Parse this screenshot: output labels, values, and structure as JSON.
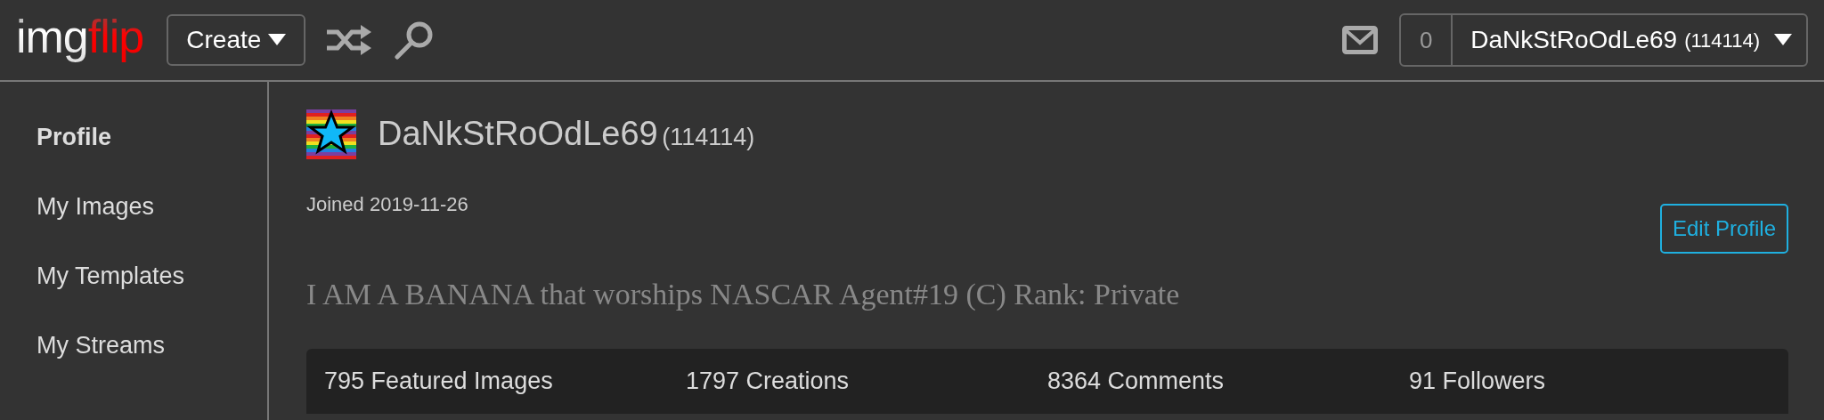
{
  "header": {
    "logo": {
      "part_1": "img",
      "part_2": "flip"
    },
    "create_button": "Create",
    "notifications_count": "0",
    "user_menu": {
      "username": "DaNkStRoOdLe69",
      "points": "(114114)"
    }
  },
  "sidebar": {
    "items": [
      {
        "label": "Profile",
        "selected": true
      },
      {
        "label": "My Images",
        "selected": false
      },
      {
        "label": "My Templates",
        "selected": false
      },
      {
        "label": "My Streams",
        "selected": false
      }
    ]
  },
  "profile": {
    "username": "DaNkStRoOdLe69",
    "points": "(114114)",
    "joined": "Joined 2019-11-26",
    "edit_button": "Edit Profile",
    "bio": "I AM A BANANA that worships NASCAR Agent#19 (C) Rank: Private",
    "stats": [
      "795 Featured Images",
      "1797 Creations",
      "8364 Comments",
      "91 Followers"
    ]
  }
}
